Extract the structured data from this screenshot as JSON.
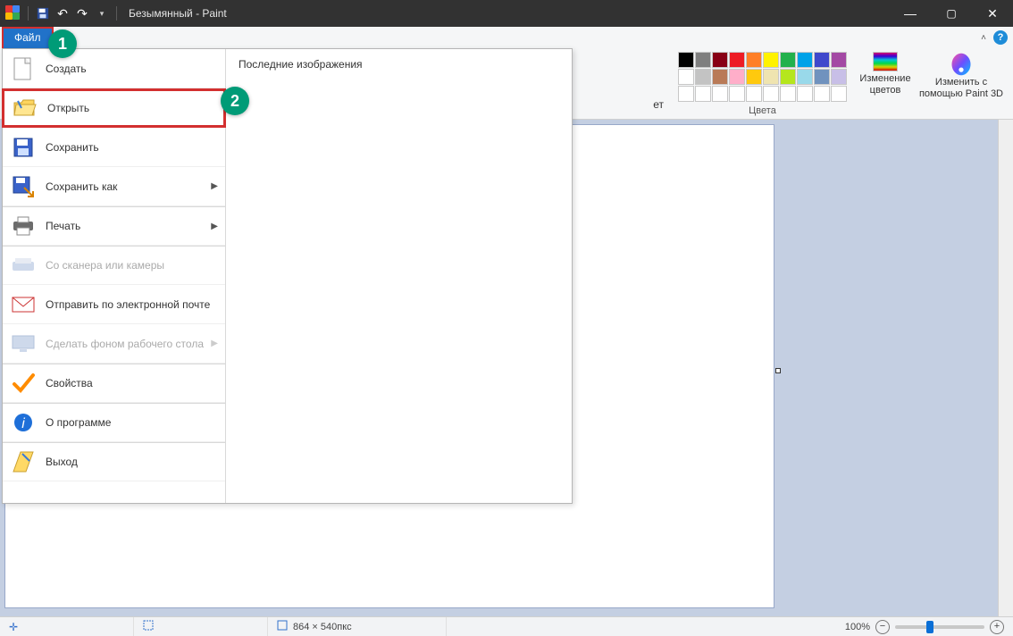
{
  "window": {
    "title": "Безымянный - Paint"
  },
  "file_tab": {
    "label": "Файл"
  },
  "annotations": {
    "one": "1",
    "two": "2"
  },
  "file_menu": {
    "recent_title": "Последние изображения",
    "items": [
      {
        "label": "Создать"
      },
      {
        "label": "Открыть"
      },
      {
        "label": "Сохранить"
      },
      {
        "label": "Сохранить как"
      },
      {
        "label": "Печать"
      },
      {
        "label": "Со сканера или камеры"
      },
      {
        "label": "Отправить по электронной почте"
      },
      {
        "label": "Сделать фоном рабочего стола"
      },
      {
        "label": "Свойства"
      },
      {
        "label": "О программе"
      },
      {
        "label": "Выход"
      }
    ]
  },
  "ribbon": {
    "truncated_word": "ет",
    "colors_label": "Цвета",
    "edit_colors_label": "Изменение цветов",
    "paint3d_line1": "Изменить с",
    "paint3d_line2": "помощью Paint 3D",
    "palette_row1": [
      "#000000",
      "#7f7f7f",
      "#880015",
      "#ed1c24",
      "#ff7f27",
      "#fff200",
      "#22b14c",
      "#00a2e8",
      "#3f48cc",
      "#a349a4"
    ],
    "palette_row2": [
      "#ffffff",
      "#c3c3c3",
      "#b97a57",
      "#ffaec9",
      "#ffc90e",
      "#efe4b0",
      "#b5e61d",
      "#99d9ea",
      "#7092be",
      "#c8bfe7"
    ],
    "palette_row3": [
      "#ffffff",
      "#ffffff",
      "#ffffff",
      "#ffffff",
      "#ffffff",
      "#ffffff",
      "#ffffff",
      "#ffffff",
      "#ffffff",
      "#ffffff"
    ]
  },
  "status": {
    "cursor": "",
    "selection": "",
    "size": "864 × 540пкс",
    "zoom": "100%",
    "slider_pct": 35
  }
}
